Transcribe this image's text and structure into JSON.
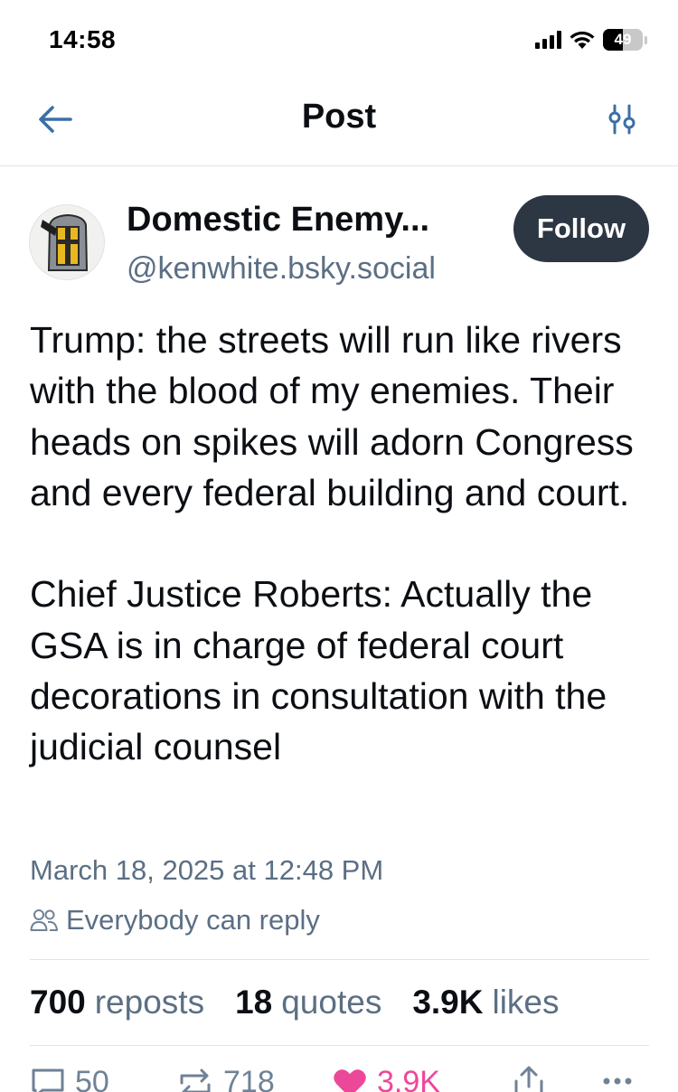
{
  "status_bar": {
    "time": "14:58",
    "battery": "49",
    "battery_level": 0.49
  },
  "header": {
    "title": "Post"
  },
  "author": {
    "display_name": "Domestic Enemy...",
    "handle": "@kenwhite.bsky.social",
    "follow_label": "Follow"
  },
  "post": {
    "text": "Trump: the streets will run like rivers with the blood of my enemies. Their heads on spikes will adorn Congress and every federal building and court.\n\nChief Justice Roberts:  Actually the GSA is in charge of federal court decorations in consultation with the judicial counsel",
    "timestamp": "March 18, 2025 at 12:48 PM",
    "reply_setting": "Everybody can reply"
  },
  "stats": {
    "reposts_count": "700",
    "reposts_label": "reposts",
    "quotes_count": "18",
    "quotes_label": "quotes",
    "likes_count": "3.9K",
    "likes_label": "likes"
  },
  "actions": {
    "reply_count": "50",
    "repost_count": "718",
    "like_count": "3.9K"
  },
  "colors": {
    "accent": "#ec4899",
    "follow_bg": "#2c3743",
    "muted": "#5b6f84",
    "back_arrow": "#3b6fa6"
  }
}
